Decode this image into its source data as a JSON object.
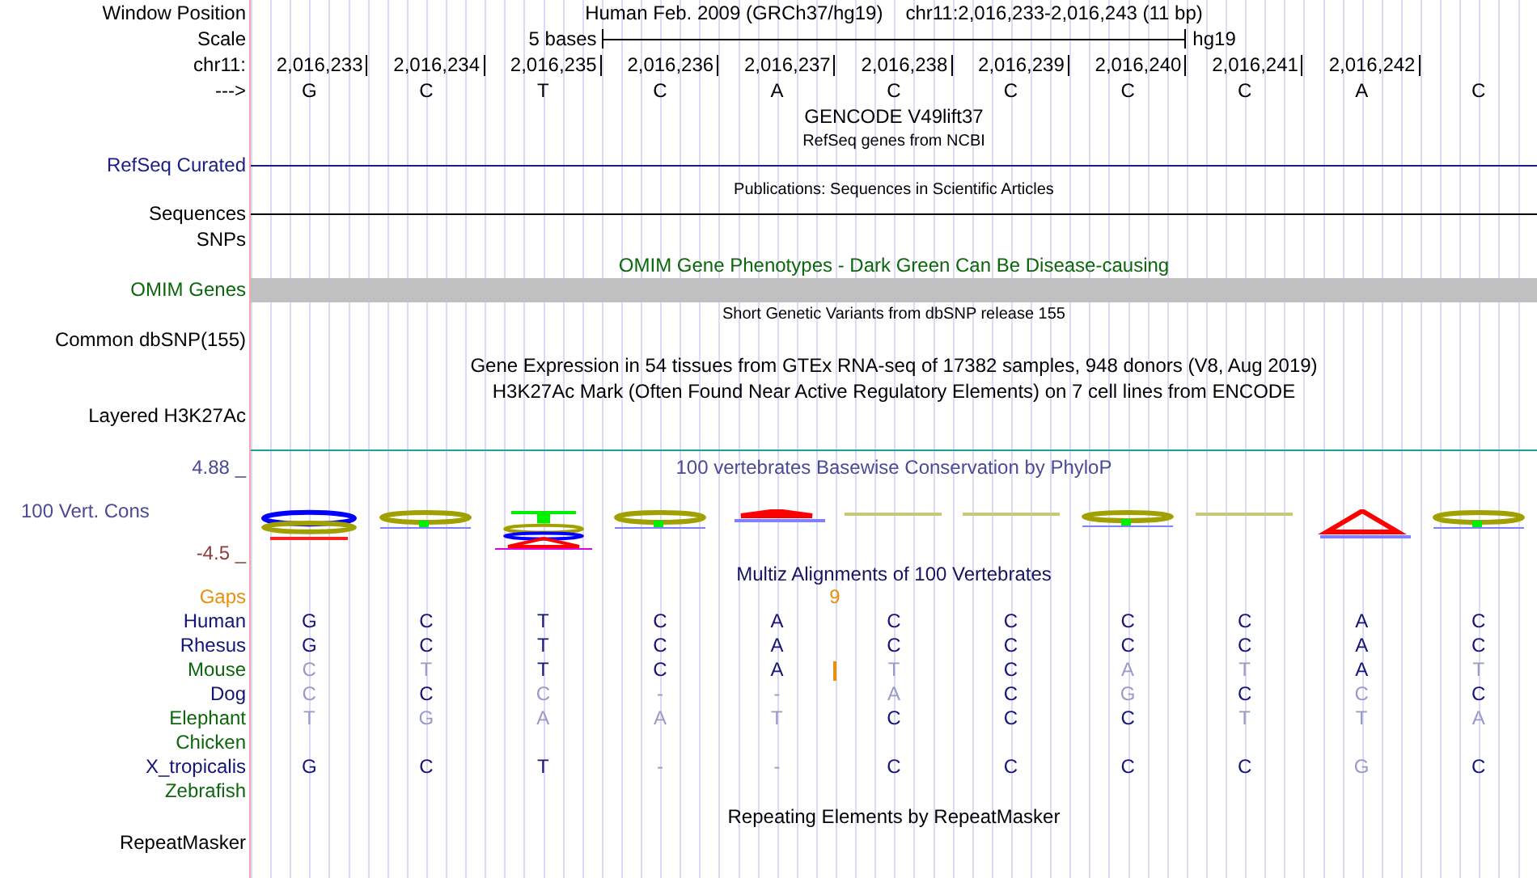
{
  "header": {
    "label": "Window Position",
    "assembly": "Human Feb. 2009 (GRCh37/hg19)",
    "range": "chr11:2,016,233-2,016,243 (11 bp)"
  },
  "scale": {
    "label": "Scale",
    "span": "5 bases",
    "db": "hg19"
  },
  "ruler": {
    "label": "chr11:",
    "ticks": [
      "2,016,233",
      "2,016,234",
      "2,016,235",
      "2,016,236",
      "2,016,237",
      "2,016,238",
      "2,016,239",
      "2,016,240",
      "2,016,241",
      "2,016,242"
    ]
  },
  "sequence": {
    "label": "--->",
    "bases": [
      {
        "base": "G"
      },
      {
        "base": "C"
      },
      {
        "base": "T"
      },
      {
        "base": "C"
      },
      {
        "base": "A",
        "gap_count": "9"
      },
      {
        "base": "C"
      },
      {
        "base": "C"
      },
      {
        "base": "C"
      },
      {
        "base": "C"
      },
      {
        "base": "A"
      },
      {
        "base": "C"
      }
    ]
  },
  "tracks": [
    {
      "kind": "title",
      "text": "GENCODE V49lift37"
    },
    {
      "kind": "subtitle",
      "text": "RefSeq genes from NCBI"
    },
    {
      "kind": "line",
      "label": "RefSeq Curated",
      "color": "#1c1c86"
    },
    {
      "kind": "subtitle",
      "text": "Publications: Sequences in Scientific Articles"
    },
    {
      "kind": "line",
      "label": "Sequences",
      "color": "#000000"
    },
    {
      "kind": "label",
      "label": "SNPs"
    },
    {
      "kind": "title",
      "text": "OMIM Gene Phenotypes - Dark Green Can Be Disease-causing",
      "color": "#0c660c"
    },
    {
      "kind": "bar",
      "label": "OMIM Genes",
      "color": "#0c660c"
    },
    {
      "kind": "subtitle",
      "text": "Short Genetic Variants from dbSNP release 155"
    },
    {
      "kind": "label",
      "label": "Common dbSNP(155)"
    },
    {
      "kind": "title",
      "text": "Gene Expression in 54 tissues from GTEx RNA-seq of 17382 samples, 948 donors (V8, Aug 2019)"
    },
    {
      "kind": "title",
      "text": "H3K27Ac Mark (Often Found Near Active Regulatory Elements) on 7 cell lines from ENCODE"
    },
    {
      "kind": "signal",
      "label": "Layered H3K27Ac"
    },
    {
      "kind": "conservation",
      "title": "100 vertebrates Basewise Conservation by PhyloP",
      "label": "100 Vert. Cons",
      "max": "4.88 _",
      "min": "-4.5 _"
    },
    {
      "kind": "alignment",
      "title": "Multiz Alignments of 100 Vertebrates",
      "gaps_label": "Gaps",
      "species": [
        {
          "name": "Human",
          "color": "#141478",
          "bases": [
            {
              "base": "G",
              "faded": false
            },
            {
              "base": "C",
              "faded": false
            },
            {
              "base": "T",
              "faded": false
            },
            {
              "base": "C",
              "faded": false
            },
            {
              "base": "A",
              "faded": false
            },
            {
              "base": "C",
              "faded": false
            },
            {
              "base": "C",
              "faded": false
            },
            {
              "base": "C",
              "faded": false
            },
            {
              "base": "C",
              "faded": false
            },
            {
              "base": "A",
              "faded": false
            },
            {
              "base": "C",
              "faded": false
            }
          ]
        },
        {
          "name": "Rhesus",
          "color": "#141478",
          "bases": [
            {
              "base": "G",
              "faded": false
            },
            {
              "base": "C",
              "faded": false
            },
            {
              "base": "T",
              "faded": false
            },
            {
              "base": "C",
              "faded": false
            },
            {
              "base": "A",
              "faded": false
            },
            {
              "base": "C",
              "faded": false
            },
            {
              "base": "C",
              "faded": false
            },
            {
              "base": "C",
              "faded": false
            },
            {
              "base": "C",
              "faded": false
            },
            {
              "base": "A",
              "faded": false
            },
            {
              "base": "C",
              "faded": false
            }
          ]
        },
        {
          "name": "Mouse",
          "color": "#0c660c",
          "bases": [
            {
              "base": "C",
              "faded": true,
              "insertion": false
            },
            {
              "base": "T",
              "faded": true,
              "insertion": false
            },
            {
              "base": "T",
              "faded": false,
              "insertion": false
            },
            {
              "base": "C",
              "faded": false,
              "insertion": false
            },
            {
              "base": "A",
              "faded": false,
              "insertion": true
            },
            {
              "base": "T",
              "faded": true,
              "insertion": false
            },
            {
              "base": "C",
              "faded": false,
              "insertion": false
            },
            {
              "base": "A",
              "faded": true,
              "insertion": false
            },
            {
              "base": "T",
              "faded": true,
              "insertion": false
            },
            {
              "base": "A",
              "faded": false,
              "insertion": false
            },
            {
              "base": "T",
              "faded": true,
              "insertion": false
            }
          ]
        },
        {
          "name": "Dog",
          "color": "#141478",
          "bases": [
            {
              "base": "C",
              "faded": true
            },
            {
              "base": "C",
              "faded": false
            },
            {
              "base": "C",
              "faded": true
            },
            {
              "base": "-",
              "faded": true
            },
            {
              "base": "-",
              "faded": true
            },
            {
              "base": "A",
              "faded": true
            },
            {
              "base": "C",
              "faded": false
            },
            {
              "base": "G",
              "faded": true
            },
            {
              "base": "C",
              "faded": false
            },
            {
              "base": "C",
              "faded": true
            },
            {
              "base": "C",
              "faded": false
            }
          ]
        },
        {
          "name": "Elephant",
          "color": "#0c660c",
          "bases": [
            {
              "base": "T",
              "faded": true
            },
            {
              "base": "G",
              "faded": true
            },
            {
              "base": "A",
              "faded": true
            },
            {
              "base": "A",
              "faded": true
            },
            {
              "base": "T",
              "faded": true
            },
            {
              "base": "C",
              "faded": false
            },
            {
              "base": "C",
              "faded": false
            },
            {
              "base": "C",
              "faded": false
            },
            {
              "base": "T",
              "faded": true
            },
            {
              "base": "T",
              "faded": true
            },
            {
              "base": "A",
              "faded": true
            }
          ]
        },
        {
          "name": "Chicken",
          "color": "#0c660c"
        },
        {
          "name": "X_tropicalis",
          "color": "#141478",
          "bases": [
            {
              "base": "G",
              "faded": false
            },
            {
              "base": "C",
              "faded": false
            },
            {
              "base": "T",
              "faded": false
            },
            {
              "base": "-",
              "faded": true
            },
            {
              "base": "-",
              "faded": true
            },
            {
              "base": "C",
              "faded": false
            },
            {
              "base": "C",
              "faded": false
            },
            {
              "base": "C",
              "faded": false
            },
            {
              "base": "C",
              "faded": false
            },
            {
              "base": "G",
              "faded": true
            },
            {
              "base": "C",
              "faded": false
            }
          ]
        },
        {
          "name": "Zebrafish",
          "color": "#0c660c"
        }
      ]
    },
    {
      "kind": "title",
      "text": "Repeating Elements by RepeatMasker"
    },
    {
      "kind": "label",
      "label": "RepeatMasker"
    }
  ]
}
